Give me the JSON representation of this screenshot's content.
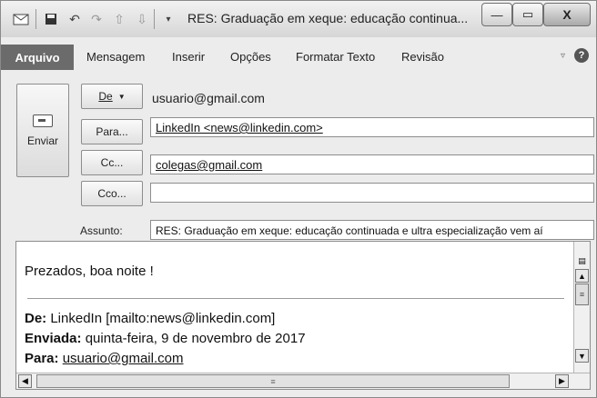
{
  "window": {
    "title": "RES: Graduação em xeque: educação continua...",
    "quick_access": {
      "app_icon": "outlook-app-icon",
      "save_icon": "save-icon",
      "undo_icon": "undo-icon",
      "redo_icon": "redo-icon",
      "up_icon": "arrow-up-icon",
      "down_icon": "arrow-down-icon",
      "customize_icon": "customize-dropdown-icon"
    },
    "minimize_label": "—",
    "maximize_label": "▭",
    "close_label": "X"
  },
  "ribbon": {
    "tabs": [
      {
        "label": "Arquivo"
      },
      {
        "label": "Mensagem"
      },
      {
        "label": "Inserir"
      },
      {
        "label": "Opções"
      },
      {
        "label": "Formatar Texto"
      },
      {
        "label": "Revisão"
      }
    ],
    "help_label": "?"
  },
  "compose": {
    "send_label": "Enviar",
    "from_label": "De",
    "from_value": "usuario@gmail.com",
    "to_label": "Para...",
    "to_value": "LinkedIn <news@linkedin.com>",
    "cc_label": "Cc...",
    "cc_value": "colegas@gmail.com",
    "bcc_label": "Cco...",
    "bcc_value": "",
    "subject_label": "Assunto:",
    "subject_value": "RES: Graduação em xeque: educação continuada e ultra especialização vem aí"
  },
  "body": {
    "greeting": "Prezados, boa noite !",
    "from_label": "De:",
    "from_value": "LinkedIn [mailto:news@linkedin.com]",
    "sent_label": "Enviada:",
    "sent_value": "quinta-feira, 9 de novembro de 2017",
    "to_label": "Para:",
    "to_value": "usuario@gmail.com"
  }
}
